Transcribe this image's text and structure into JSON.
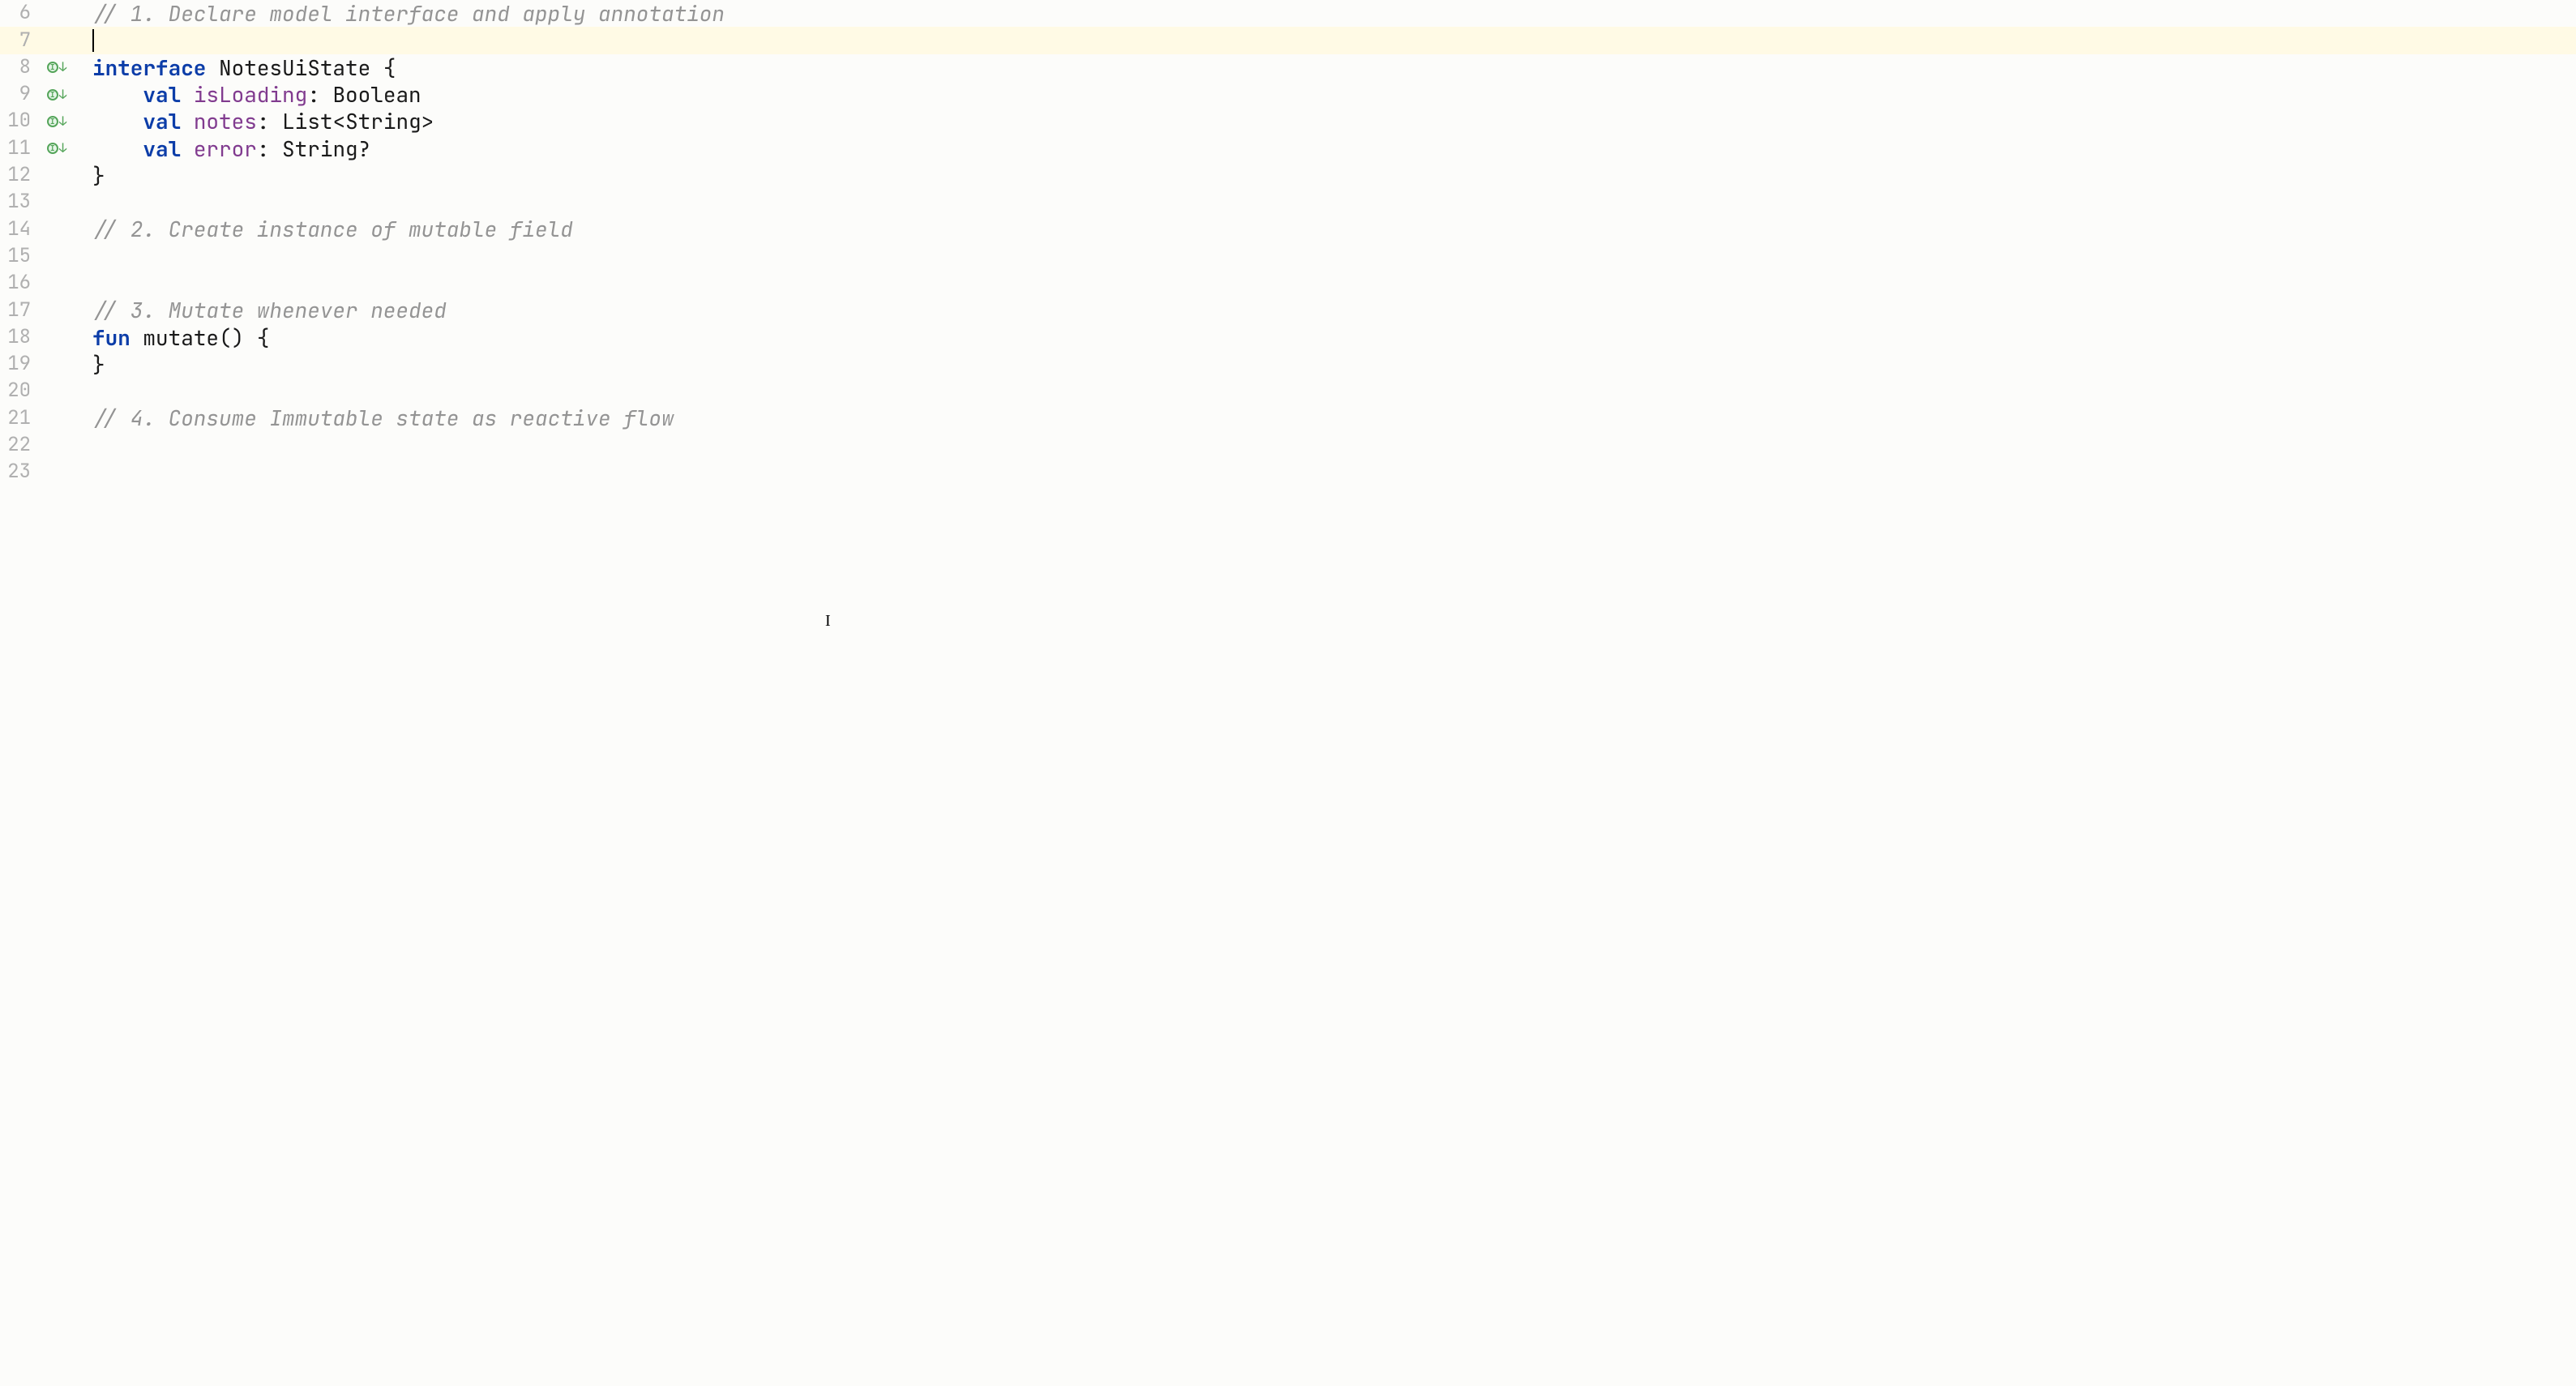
{
  "lines": [
    {
      "num": "6",
      "icon": "",
      "tokens": [
        [
          "comment",
          "// 1. Declare model interface and apply annotation"
        ]
      ]
    },
    {
      "num": "7",
      "icon": "",
      "highlighted": true,
      "tokens": [
        [
          "caret",
          ""
        ]
      ]
    },
    {
      "num": "8",
      "icon": "impl-down",
      "tokens": [
        [
          "kw",
          "interface"
        ],
        [
          "punc",
          " "
        ],
        [
          "typ",
          "NotesUiState"
        ],
        [
          "punc",
          " {"
        ]
      ]
    },
    {
      "num": "9",
      "icon": "impl-down",
      "tokens": [
        [
          "punc",
          "    "
        ],
        [
          "kw",
          "val"
        ],
        [
          "punc",
          " "
        ],
        [
          "prop",
          "isLoading"
        ],
        [
          "punc",
          ": "
        ],
        [
          "builtin",
          "Boolean"
        ]
      ]
    },
    {
      "num": "10",
      "icon": "impl-down",
      "tokens": [
        [
          "punc",
          "    "
        ],
        [
          "kw",
          "val"
        ],
        [
          "punc",
          " "
        ],
        [
          "prop",
          "notes"
        ],
        [
          "punc",
          ": "
        ],
        [
          "builtin",
          "List"
        ],
        [
          "punc",
          "<"
        ],
        [
          "builtin",
          "String"
        ],
        [
          "punc",
          ">"
        ]
      ]
    },
    {
      "num": "11",
      "icon": "impl-down",
      "tokens": [
        [
          "punc",
          "    "
        ],
        [
          "kw",
          "val"
        ],
        [
          "punc",
          " "
        ],
        [
          "prop",
          "error"
        ],
        [
          "punc",
          ": "
        ],
        [
          "builtin",
          "String"
        ],
        [
          "punc",
          "?"
        ]
      ]
    },
    {
      "num": "12",
      "icon": "",
      "tokens": [
        [
          "punc",
          "}"
        ]
      ]
    },
    {
      "num": "13",
      "icon": "",
      "tokens": []
    },
    {
      "num": "14",
      "icon": "",
      "tokens": [
        [
          "comment",
          "// 2. Create instance of mutable field"
        ]
      ]
    },
    {
      "num": "15",
      "icon": "",
      "tokens": []
    },
    {
      "num": "16",
      "icon": "",
      "tokens": []
    },
    {
      "num": "17",
      "icon": "",
      "tokens": [
        [
          "comment",
          "// 3. Mutate whenever needed"
        ]
      ]
    },
    {
      "num": "18",
      "icon": "",
      "tokens": [
        [
          "kw",
          "fun"
        ],
        [
          "punc",
          " "
        ],
        [
          "fn-name",
          "mutate"
        ],
        [
          "punc",
          "() {"
        ]
      ]
    },
    {
      "num": "19",
      "icon": "",
      "tokens": [
        [
          "punc",
          "}"
        ]
      ]
    },
    {
      "num": "20",
      "icon": "",
      "tokens": []
    },
    {
      "num": "21",
      "icon": "",
      "tokens": [
        [
          "comment",
          "// 4. Consume Immutable state as reactive flow"
        ]
      ]
    },
    {
      "num": "22",
      "icon": "",
      "tokens": []
    },
    {
      "num": "23",
      "icon": "",
      "tokens": []
    }
  ],
  "icon_glyph": "I",
  "text_cursor_glyph": "I"
}
